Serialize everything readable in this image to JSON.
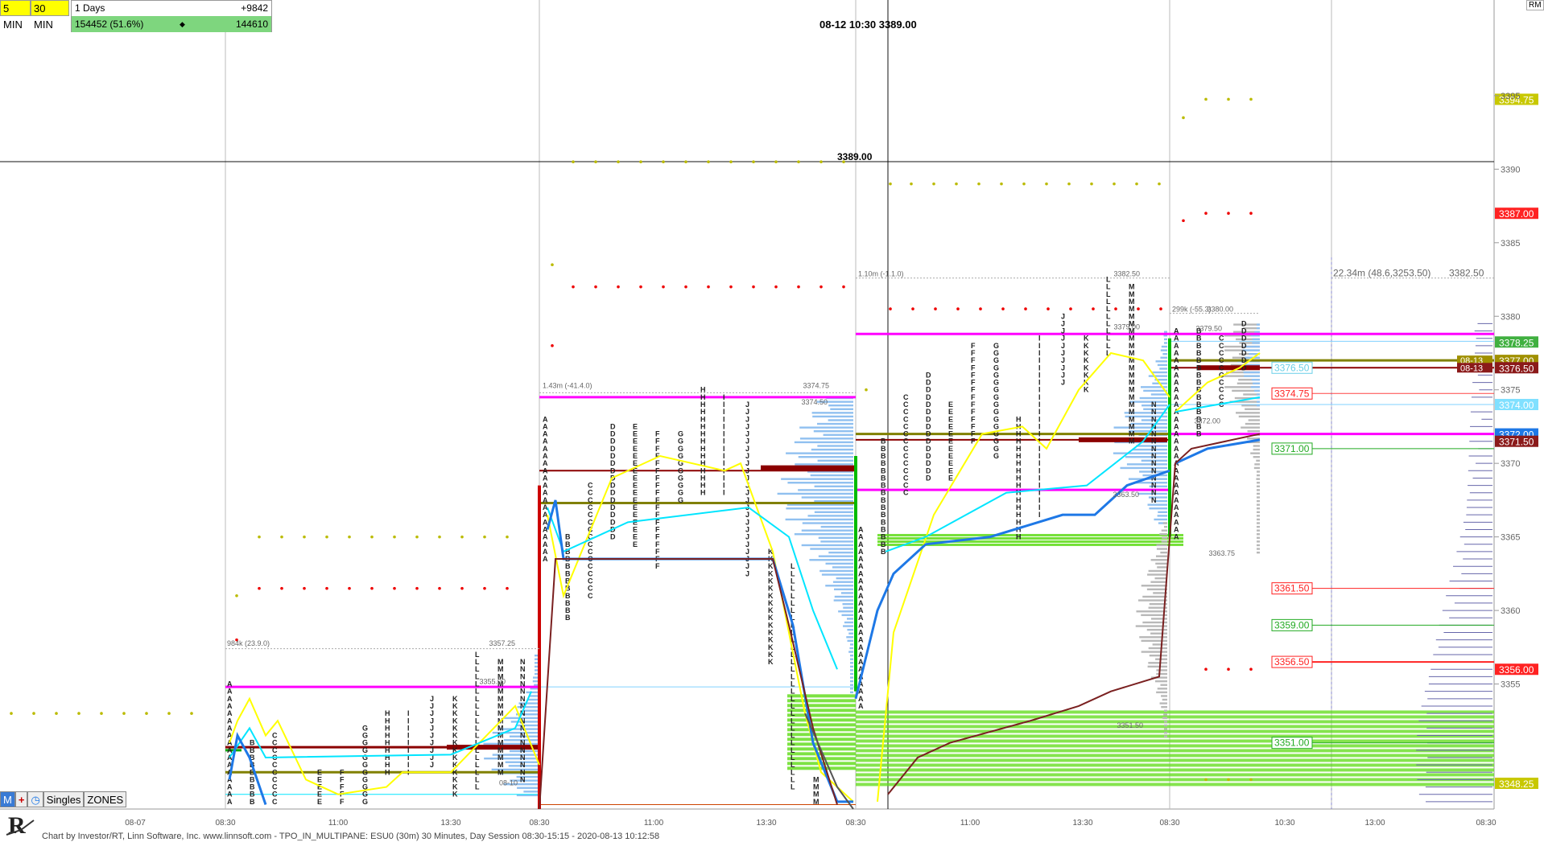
{
  "header": {
    "btn_5min": "5 MIN",
    "btn_30min": "30 MIN",
    "stat_days": "1 Days",
    "stat_delta": "+9842",
    "stat_volume": "154452 (51.6%)",
    "stat_diamond": "◆",
    "stat_other": "144610",
    "crosshair_label": "08-12 10:30",
    "crosshair_value": "3389.00",
    "rm_label": "RM"
  },
  "toolbar": {
    "m_label": "M",
    "singles_label": "Singles",
    "zones_label": "ZONES"
  },
  "footer": {
    "text": "Chart by Investor/RT, Linn Software, Inc. www.linnsoft.com - TPO_IN_MULTIPANE: ESU0 (30m) 30 Minutes, Day Session 08:30-15:15 - 2020-08-13 10:12:58"
  },
  "colors": {
    "magenta": "#ff00ff",
    "darkred": "#8b0000",
    "olive": "#808000",
    "cyan": "#00e5ff",
    "blue": "#1e78e6",
    "yellow": "#ffff00",
    "green_zone": "#66dd22",
    "profile_blue": "#90c0f0",
    "brown": "#7a2020"
  },
  "chart_data": {
    "type": "tpo_profile",
    "ylim": [
      3346.5,
      3401.5
    ],
    "price_ticks": [
      "3395",
      "3390",
      "3385",
      "3380",
      "3375",
      "3370",
      "3365",
      "3360",
      "3355"
    ],
    "time_ticks": [
      "08-07",
      "08:30",
      "11:00",
      "13:30",
      "08:30",
      "11:00",
      "13:30",
      "08:30",
      "11:00",
      "13:30",
      "08:30",
      "10:30",
      "13:00",
      "08:30"
    ],
    "price_axis_tags": [
      {
        "label": "3394.75",
        "price": 3394.75,
        "color": "#c8c800"
      },
      {
        "label": "3387.00",
        "price": 3387.0,
        "color": "#ff2222"
      },
      {
        "label": "3378.25",
        "price": 3378.25,
        "color": "#40b040"
      },
      {
        "label": "3377.00",
        "price": 3377.0,
        "color": "#a09000"
      },
      {
        "label": "3376.50",
        "price": 3376.5,
        "color": "#8b1a1a"
      },
      {
        "label": "3374.00",
        "price": 3374.0,
        "color": "#80e0ff"
      },
      {
        "label": "3372.00",
        "price": 3372.0,
        "color": "#1e78e6"
      },
      {
        "label": "3371.50",
        "price": 3371.5,
        "color": "#8b1a1a"
      },
      {
        "label": "3356.00",
        "price": 3356.0,
        "color": "#ff2222"
      },
      {
        "label": "3348.25",
        "price": 3348.25,
        "color": "#c8c800"
      }
    ],
    "inline_tags": [
      "08-13",
      "08-13"
    ],
    "level_labels": [
      {
        "label": "3376.50",
        "price": 3376.5,
        "color": "#6ad0e8"
      },
      {
        "label": "3374.75",
        "price": 3374.75,
        "color": "#ff2222"
      },
      {
        "label": "3371.00",
        "price": 3371.0,
        "color": "#22aa22"
      },
      {
        "label": "3361.50",
        "price": 3361.5,
        "color": "#ff2222"
      },
      {
        "label": "3359.00",
        "price": 3359.0,
        "color": "#22aa22"
      },
      {
        "label": "3356.50",
        "price": 3356.5,
        "color": "#ff2222"
      },
      {
        "label": "3351.00",
        "price": 3351.0,
        "color": "#22aa22"
      }
    ],
    "profile_annotations": [
      {
        "label": "984k (23.9.0)",
        "price": 3357.5
      },
      {
        "label": "3357.25",
        "price": 3357.5
      },
      {
        "label": "3355.00",
        "price": 3354.9
      },
      {
        "label": "08-10",
        "price": 3348.0
      },
      {
        "label": "1.43m (-41.4.0)",
        "price": 3375.0
      },
      {
        "label": "3374.75",
        "price": 3375.0
      },
      {
        "label": "3374.50",
        "price": 3373.9
      },
      {
        "label": "1.10m (-1.1.0)",
        "price": 3382.6
      },
      {
        "label": "3382.50",
        "price": 3382.6
      },
      {
        "label": "3379.00",
        "price": 3379.0
      },
      {
        "label": "3363.50",
        "price": 3367.6
      },
      {
        "label": "3351.50",
        "price": 3351.9
      },
      {
        "label": "299k (-55.3)",
        "price": 3380.2
      },
      {
        "label": "3380.00",
        "price": 3380.2
      },
      {
        "label": "3379.50",
        "price": 3378.9
      },
      {
        "label": "3372.00",
        "price": 3372.6
      },
      {
        "label": "3363.75",
        "price": 3363.6
      },
      {
        "label": "22.34m (48.6,3253.50)",
        "price": 3382.6
      },
      {
        "label": "3382.50",
        "price": 3382.6
      }
    ],
    "tpo_columns": [
      {
        "letter": "A",
        "top": 3355.0,
        "bottom": 3347.0
      },
      {
        "letter": "B",
        "top": 3351.0,
        "bottom": 3346.5
      },
      {
        "letter": "C",
        "top": 3351.5,
        "bottom": 3346.5
      },
      {
        "letter": "E",
        "top": 3349.0,
        "bottom": 3346.5
      },
      {
        "letter": "F",
        "top": 3349.0,
        "bottom": 3346.5
      },
      {
        "letter": "G",
        "top": 3352.0,
        "bottom": 3346.5
      },
      {
        "letter": "H",
        "top": 3353.0,
        "bottom": 3349.0
      },
      {
        "letter": "I",
        "top": 3353.0,
        "bottom": 3349.0
      },
      {
        "letter": "J",
        "top": 3354.0,
        "bottom": 3349.5
      },
      {
        "letter": "K",
        "top": 3354.0,
        "bottom": 3347.5
      },
      {
        "letter": "L",
        "top": 3357.0,
        "bottom": 3348.0
      },
      {
        "letter": "M",
        "top": 3356.5,
        "bottom": 3349.0
      },
      {
        "letter": "N",
        "top": 3356.5,
        "bottom": 3348.5
      },
      {
        "letter": "A",
        "top": 3373.0,
        "bottom": 3363.5
      },
      {
        "letter": "B",
        "top": 3365.0,
        "bottom": 3359.5
      },
      {
        "letter": "C",
        "top": 3368.5,
        "bottom": 3361.0
      },
      {
        "letter": "D",
        "top": 3372.5,
        "bottom": 3365.0
      },
      {
        "letter": "E",
        "top": 3372.5,
        "bottom": 3364.5
      },
      {
        "letter": "F",
        "top": 3372.0,
        "bottom": 3363.0
      },
      {
        "letter": "G",
        "top": 3372.0,
        "bottom": 3367.5
      },
      {
        "letter": "H",
        "top": 3375.0,
        "bottom": 3368.0
      },
      {
        "letter": "I",
        "top": 3374.5,
        "bottom": 3368.0
      },
      {
        "letter": "J",
        "top": 3374.0,
        "bottom": 3362.5
      },
      {
        "letter": "K",
        "top": 3364.0,
        "bottom": 3356.5
      },
      {
        "letter": "L",
        "top": 3363.0,
        "bottom": 3348.0
      },
      {
        "letter": "M",
        "top": 3348.5,
        "bottom": 3347.0
      },
      {
        "letter": "A",
        "top": 3365.5,
        "bottom": 3353.5
      },
      {
        "letter": "B",
        "top": 3371.5,
        "bottom": 3364.0
      },
      {
        "letter": "C",
        "top": 3374.5,
        "bottom": 3368.0
      },
      {
        "letter": "D",
        "top": 3376.0,
        "bottom": 3369.0
      },
      {
        "letter": "E",
        "top": 3374.0,
        "bottom": 3369.0
      },
      {
        "letter": "F",
        "top": 3378.0,
        "bottom": 3371.5
      },
      {
        "letter": "G",
        "top": 3378.0,
        "bottom": 3370.5
      },
      {
        "letter": "H",
        "top": 3373.0,
        "bottom": 3365.0
      },
      {
        "letter": "I",
        "top": 3378.5,
        "bottom": 3366.5
      },
      {
        "letter": "J",
        "top": 3380.0,
        "bottom": 3375.5
      },
      {
        "letter": "K",
        "top": 3378.5,
        "bottom": 3375.0
      },
      {
        "letter": "L",
        "top": 3382.5,
        "bottom": 3377.5
      },
      {
        "letter": "M",
        "top": 3382.0,
        "bottom": 3371.5
      },
      {
        "letter": "N",
        "top": 3374.0,
        "bottom": 3367.5
      },
      {
        "letter": "A",
        "top": 3379.0,
        "bottom": 3365.0
      },
      {
        "letter": "B",
        "top": 3379.0,
        "bottom": 3372.0
      },
      {
        "letter": "C",
        "top": 3378.5,
        "bottom": 3374.0
      },
      {
        "letter": "D",
        "top": 3379.5,
        "bottom": 3376.5
      }
    ]
  }
}
